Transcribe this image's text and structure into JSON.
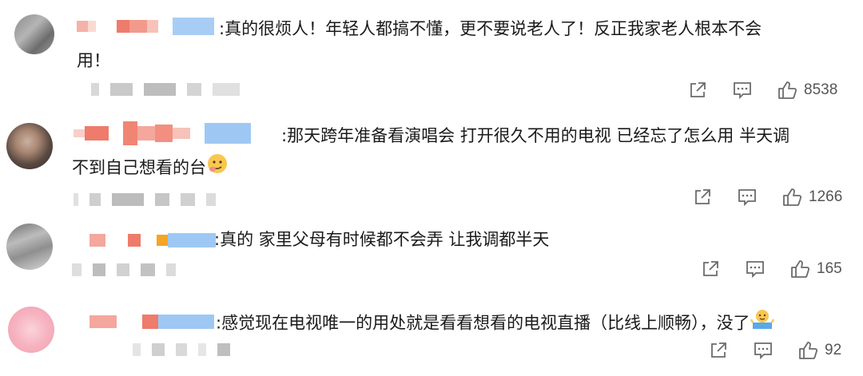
{
  "comments": [
    {
      "text_line1": ":真的很烦人！年轻人都搞不懂，更不要说老人了！反正我家老人根本不会",
      "text_line2": "用！",
      "likes": "8538",
      "share_icon": "share-icon",
      "comment_icon": "comment-icon",
      "like_icon": "thumbs-up-icon"
    },
    {
      "text_line1": ":那天跨年准备看演唱会 打开很久不用的电视 已经忘了怎么用 半天调",
      "text_line2": "不到自己想看的台",
      "emoji": "thinking-face-emoji",
      "likes": "1266"
    },
    {
      "text_line1": ":真的 家里父母有时候都不会弄 让我调都半天",
      "likes": "165"
    },
    {
      "text_line1": ":感觉现在电视唯一的用处就是看看想看的电视直播（比线上顺畅），没了",
      "emoji": "shrug-emoji",
      "likes": "92"
    }
  ],
  "colors": {
    "mosaic_pink": "#f4a79c",
    "mosaic_red": "#ee7b6b",
    "mosaic_blue": "#9ec8f3",
    "mosaic_gray": "#cfcfcf",
    "icon_gray": "#6b6b6b"
  }
}
